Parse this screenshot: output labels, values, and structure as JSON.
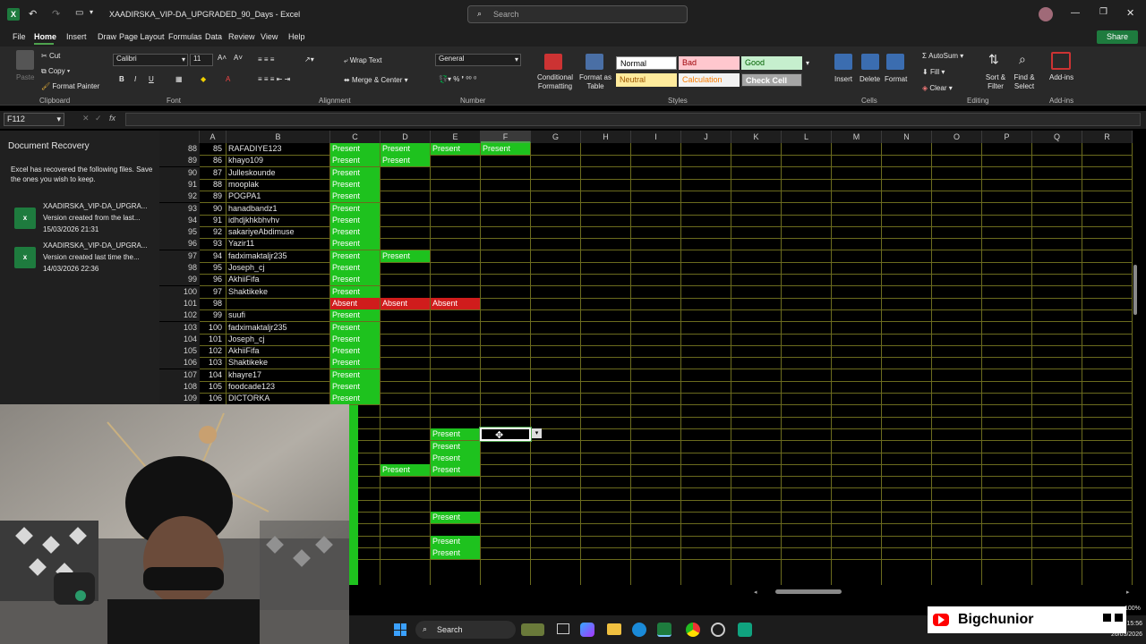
{
  "titlebar": {
    "file_name": "XAADIRSKA_VIP-DA_UPGRADED_90_Days",
    "separator": "-",
    "app_name": "Excel",
    "search_placeholder": "Search"
  },
  "menu": [
    "File",
    "Home",
    "Insert",
    "Draw",
    "Page Layout",
    "Formulas",
    "Data",
    "Review",
    "View",
    "Help"
  ],
  "active_tab": "Home",
  "share_label": "Share",
  "ribbon": {
    "clipboard": {
      "paste": "Paste",
      "cut": "Cut",
      "copy": "Copy",
      "format_painter": "Format Painter",
      "group": "Clipboard"
    },
    "font": {
      "name": "Calibri",
      "size": "11",
      "group": "Font"
    },
    "alignment": {
      "wrap": "Wrap Text",
      "merge": "Merge & Center",
      "group": "Alignment"
    },
    "number": {
      "format": "General",
      "group": "Number"
    },
    "styles": {
      "conditional": "Conditional Formatting",
      "format_table": "Format as Table",
      "normal": "Normal",
      "bad": "Bad",
      "good": "Good",
      "neutral": "Neutral",
      "calculation": "Calculation",
      "check_cell": "Check Cell",
      "group": "Styles"
    },
    "cells": {
      "insert": "Insert",
      "delete": "Delete",
      "format": "Format",
      "group": "Cells"
    },
    "editing": {
      "autosum": "AutoSum",
      "fill": "Fill",
      "clear": "Clear",
      "sort": "Sort & Filter",
      "find": "Find & Select",
      "group": "Editing"
    },
    "addins": {
      "label": "Add-ins",
      "group": "Add-ins"
    }
  },
  "formula_bar": {
    "name_box": "F112",
    "fx": "fx",
    "value": ""
  },
  "recovery": {
    "title": "Document Recovery",
    "message": "Excel has recovered the following files.  Save the ones you wish to keep.",
    "files": [
      {
        "name": "XAADIRSKA_VIP-DA_UPGRA...",
        "desc": "Version created from the last...",
        "date": "15/03/2026 21:31"
      },
      {
        "name": "XAADIRSKA_VIP-DA_UPGRA...",
        "desc": "Version created last time the...",
        "date": "14/03/2026 22:36"
      }
    ]
  },
  "columns": [
    "A",
    "B",
    "C",
    "D",
    "E",
    "F",
    "G",
    "H",
    "I",
    "J",
    "K",
    "L",
    "M",
    "N",
    "O",
    "P",
    "Q",
    "R"
  ],
  "rows": [
    {
      "r": "88",
      "a": "85",
      "b": "RAFADIYE123",
      "c": "Present",
      "d": "Present",
      "e": "Present",
      "f": "Present"
    },
    {
      "r": "89",
      "a": "86",
      "b": "khayo109",
      "c": "Present",
      "d": "Present",
      "e": "",
      "f": ""
    },
    {
      "r": "90",
      "a": "87",
      "b": "Julleskounde",
      "c": "Present",
      "d": "",
      "e": "",
      "f": ""
    },
    {
      "r": "91",
      "a": "88",
      "b": "mooplak",
      "c": "Present",
      "d": "",
      "e": "",
      "f": ""
    },
    {
      "r": "92",
      "a": "89",
      "b": "POGPA1",
      "c": "Present",
      "d": "",
      "e": "",
      "f": ""
    },
    {
      "r": "93",
      "a": "90",
      "b": "hanadbandz1",
      "c": "Present",
      "d": "",
      "e": "",
      "f": ""
    },
    {
      "r": "94",
      "a": "91",
      "b": "idhdjkhkbhvhv",
      "c": "Present",
      "d": "",
      "e": "",
      "f": ""
    },
    {
      "r": "95",
      "a": "92",
      "b": "sakariyeAbdimuse",
      "c": "Present",
      "d": "",
      "e": "",
      "f": ""
    },
    {
      "r": "96",
      "a": "93",
      "b": "Yazir11",
      "c": "Present",
      "d": "",
      "e": "",
      "f": ""
    },
    {
      "r": "97",
      "a": "94",
      "b": "fadximaktaljr235",
      "c": "Present",
      "d": "Present",
      "e": "",
      "f": ""
    },
    {
      "r": "98",
      "a": "95",
      "b": "Joseph_cj",
      "c": "Present",
      "d": "",
      "e": "",
      "f": ""
    },
    {
      "r": "99",
      "a": "96",
      "b": "AkhiiFifa",
      "c": "Present",
      "d": "",
      "e": "",
      "f": ""
    },
    {
      "r": "100",
      "a": "97",
      "b": "Shaktikeke",
      "c": "Present",
      "d": "",
      "e": "",
      "f": ""
    },
    {
      "r": "101",
      "a": "98",
      "b": "",
      "c": "Absent",
      "d": "Absent",
      "e": "Absent",
      "f": ""
    },
    {
      "r": "102",
      "a": "99",
      "b": "suufi",
      "c": "Present",
      "d": "",
      "e": "",
      "f": ""
    },
    {
      "r": "103",
      "a": "100",
      "b": "fadximaktaljr235",
      "c": "Present",
      "d": "",
      "e": "",
      "f": ""
    },
    {
      "r": "104",
      "a": "101",
      "b": "Joseph_cj",
      "c": "Present",
      "d": "",
      "e": "",
      "f": ""
    },
    {
      "r": "105",
      "a": "102",
      "b": "AkhiiFifa",
      "c": "Present",
      "d": "",
      "e": "",
      "f": ""
    },
    {
      "r": "106",
      "a": "103",
      "b": "Shaktikeke",
      "c": "Present",
      "d": "",
      "e": "",
      "f": ""
    },
    {
      "r": "107",
      "a": "104",
      "b": "khayre17",
      "c": "Present",
      "d": "",
      "e": "",
      "f": ""
    },
    {
      "r": "108",
      "a": "105",
      "b": "foodcade123",
      "c": "Present",
      "d": "",
      "e": "",
      "f": ""
    },
    {
      "r": "109",
      "a": "106",
      "b": "DICTORKA",
      "c": "Present",
      "d": "",
      "e": "",
      "f": ""
    },
    {
      "r": "",
      "a": "",
      "b": "",
      "c": "",
      "d": "",
      "e": "",
      "f": ""
    },
    {
      "r": "",
      "a": "",
      "b": "",
      "c": "",
      "d": "",
      "e": "",
      "f": ""
    },
    {
      "r": "",
      "a": "",
      "b": "",
      "c": "",
      "d": "",
      "e": "Present",
      "f": ""
    },
    {
      "r": "",
      "a": "",
      "b": "",
      "c": "",
      "d": "",
      "e": "Present",
      "f": ""
    },
    {
      "r": "",
      "a": "",
      "b": "",
      "c": "",
      "d": "",
      "e": "Present",
      "f": ""
    },
    {
      "r": "",
      "a": "",
      "b": "",
      "c": "",
      "d": "Present",
      "e": "Present",
      "f": ""
    },
    {
      "r": "",
      "a": "",
      "b": "",
      "c": "",
      "d": "",
      "e": "",
      "f": ""
    },
    {
      "r": "",
      "a": "",
      "b": "",
      "c": "",
      "d": "",
      "e": "",
      "f": ""
    },
    {
      "r": "",
      "a": "",
      "b": "",
      "c": "",
      "d": "",
      "e": "",
      "f": ""
    },
    {
      "r": "",
      "a": "",
      "b": "",
      "c": "",
      "d": "",
      "e": "Present",
      "f": ""
    },
    {
      "r": "",
      "a": "",
      "b": "",
      "c": "",
      "d": "",
      "e": "",
      "f": ""
    },
    {
      "r": "",
      "a": "",
      "b": "",
      "c": "",
      "d": "",
      "e": "Present",
      "f": ""
    },
    {
      "r": "",
      "a": "",
      "b": "",
      "c": "",
      "d": "",
      "e": "Present",
      "f": ""
    }
  ],
  "selected_cell": "F112",
  "taskbar": {
    "search": "Search",
    "time": "15:56",
    "date": "26/03/2026"
  },
  "zoom": "100%",
  "youtube": {
    "channel": "Bigchunior"
  },
  "colors": {
    "present": "#1ec21e",
    "absent": "#d01c1c",
    "gridline": "#6b6b1e",
    "accent": "#1e7b3e"
  }
}
